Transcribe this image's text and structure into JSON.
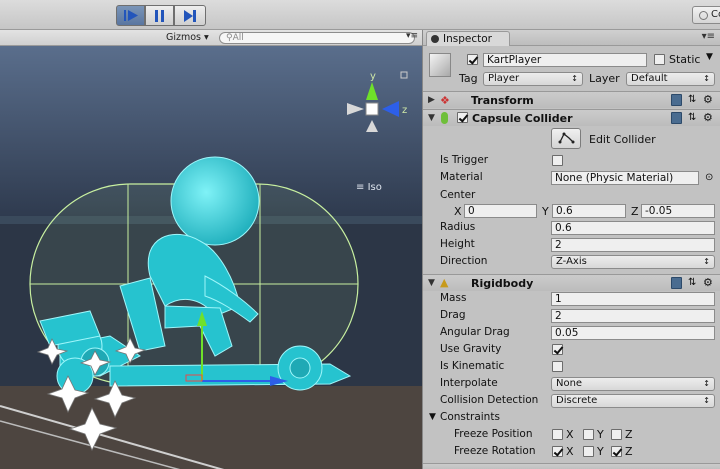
{
  "toolbar": {
    "collab_label": "Co"
  },
  "scene": {
    "menu_icon": "▾≡",
    "gizmos_label": "Gizmos",
    "search_placeholder": "All",
    "iso_label": "Iso",
    "axis_y": "y",
    "axis_z": "z"
  },
  "inspector": {
    "tab_label": "Inspector",
    "menu_icon": "▾≡",
    "object": {
      "name": "KartPlayer",
      "active": true,
      "static_label": "Static",
      "static_checked": false,
      "tag_label": "Tag",
      "tag_value": "Player",
      "layer_label": "Layer",
      "layer_value": "Default"
    },
    "transform": {
      "title": "Transform"
    },
    "capsule": {
      "title": "Capsule Collider",
      "enabled": true,
      "edit_label": "Edit Collider",
      "is_trigger_label": "Is Trigger",
      "is_trigger": false,
      "material_label": "Material",
      "material_value": "None (Physic Material)",
      "center_label": "Center",
      "x_label": "X",
      "x_value": "0",
      "y_label": "Y",
      "y_value": "0.6",
      "z_label": "Z",
      "z_value": "-0.05",
      "radius_label": "Radius",
      "radius_value": "0.6",
      "height_label": "Height",
      "height_value": "2",
      "direction_label": "Direction",
      "direction_value": "Z-Axis"
    },
    "rigidbody": {
      "title": "Rigidbody",
      "mass_label": "Mass",
      "mass_value": "1",
      "drag_label": "Drag",
      "drag_value": "2",
      "angular_drag_label": "Angular Drag",
      "angular_drag_value": "0.05",
      "use_gravity_label": "Use Gravity",
      "use_gravity": true,
      "is_kinematic_label": "Is Kinematic",
      "is_kinematic": false,
      "interpolate_label": "Interpolate",
      "interpolate_value": "None",
      "collision_label": "Collision Detection",
      "collision_value": "Discrete",
      "constraints_label": "Constraints",
      "freeze_position_label": "Freeze Position",
      "freeze_rotation_label": "Freeze Rotation",
      "x_label": "X",
      "y_label": "Y",
      "z_label": "Z",
      "freeze_position": {
        "x": false,
        "y": false,
        "z": false
      },
      "freeze_rotation": {
        "x": true,
        "y": false,
        "z": true
      }
    }
  },
  "colors": {
    "kart": "#2ec9d3",
    "accent_blue": "#4a74c2"
  }
}
